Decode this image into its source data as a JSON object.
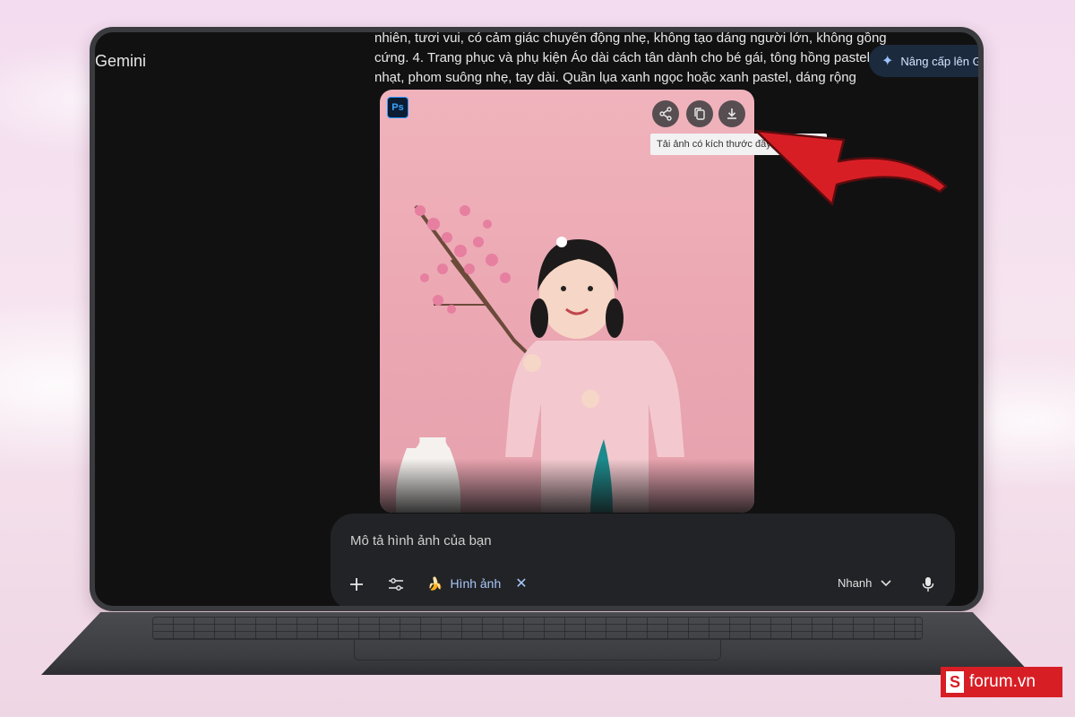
{
  "app": {
    "title": "Gemini"
  },
  "response": {
    "lines": [
      "nhiên, tươi vui, có cảm giác chuyển động nhẹ, không tạo dáng người lớn, không gồng",
      "cứng. 4. Trang phục và phụ kiện Áo dài cách tân dành cho bé gái, tông hồng pastel",
      "nhạt, phom suông nhẹ, tay dài. Quần lụa xanh ngọc hoặc xanh pastel, dáng rộng"
    ]
  },
  "header": {
    "upgrade_label": "Nâng cấp lên Google AI Pro"
  },
  "image_card": {
    "badge": "Ps",
    "actions": [
      "share-icon",
      "copy-icon",
      "download-icon"
    ],
    "download_tooltip": "Tải ảnh có kích thước đầy đủ xuống"
  },
  "prompt": {
    "placeholder": "Mô tả hình ảnh của bạn",
    "chip_label": "Hình ảnh",
    "chip_emoji": "🍌",
    "mode_label": "Nhanh"
  },
  "watermark": {
    "logo_letter": "S",
    "text": "forum.vn"
  },
  "colors": {
    "accent": "#a8c7fa",
    "arrow": "#d81e25",
    "card_bg": "#eba7b2"
  }
}
